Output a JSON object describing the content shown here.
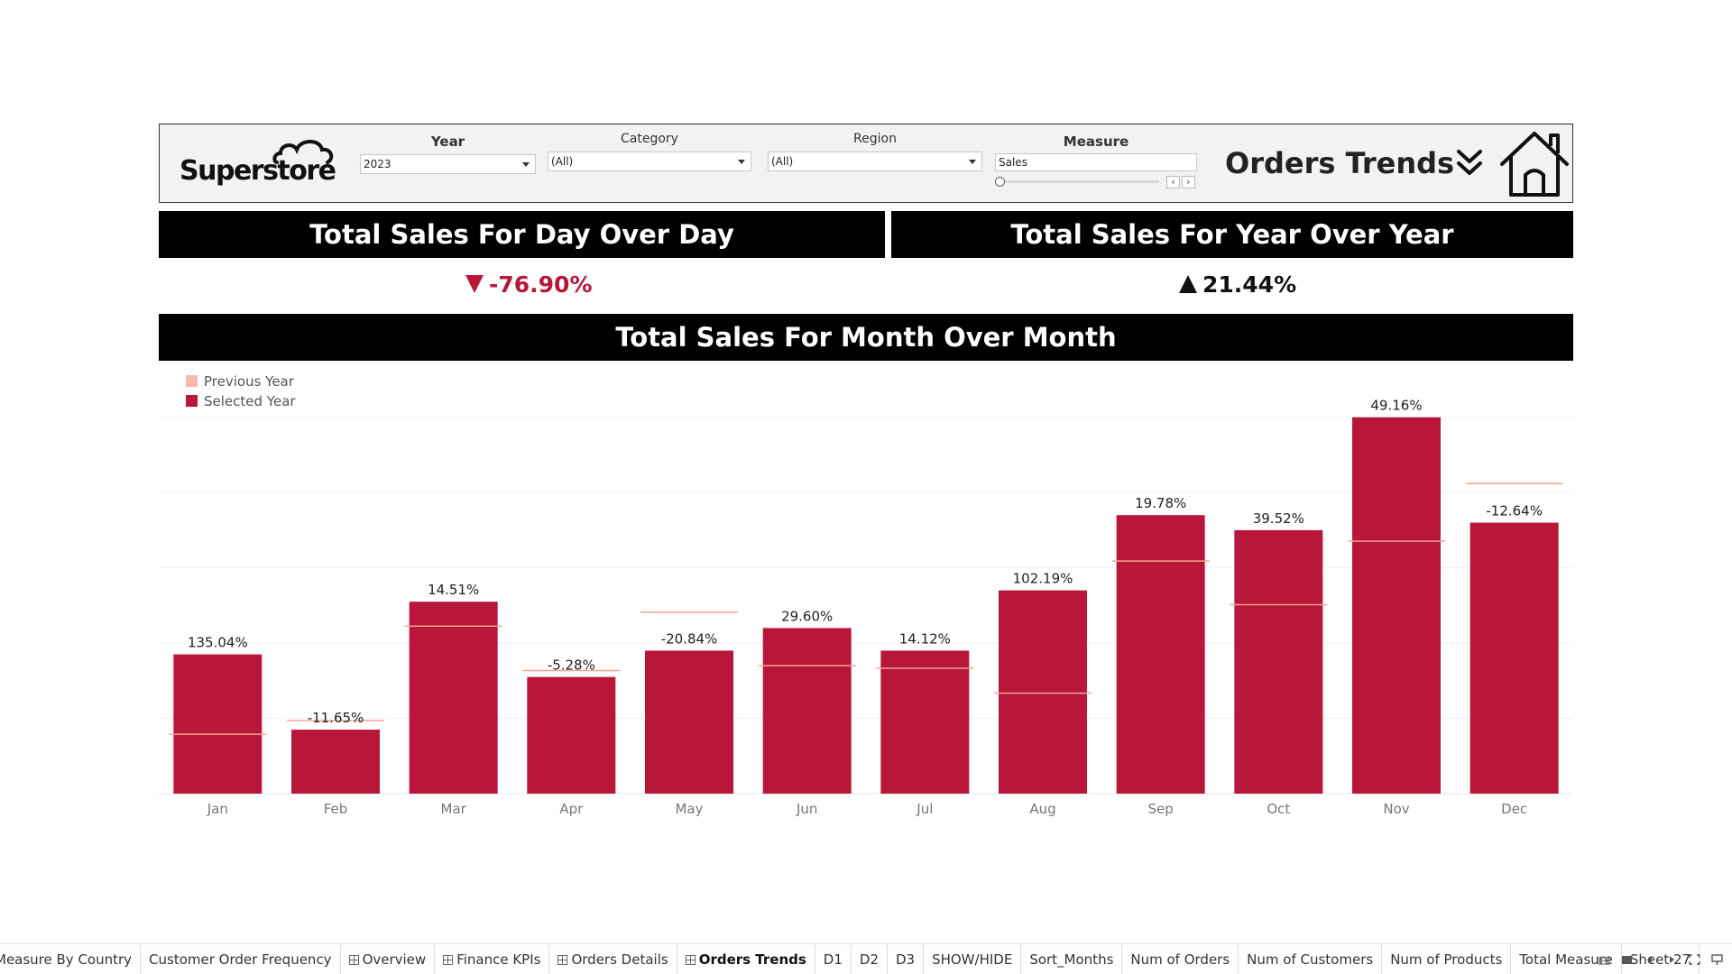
{
  "header": {
    "logo_text": "Superstore",
    "title": "Orders Trends"
  },
  "filters": {
    "year": {
      "label": "Year",
      "value": "2023"
    },
    "category": {
      "label": "Category",
      "value": "(All)"
    },
    "region": {
      "label": "Region",
      "value": "(All)"
    },
    "measure": {
      "label": "Measure",
      "value": "Sales"
    }
  },
  "kpis": {
    "dod": {
      "title": "Total Sales For Day Over Day",
      "value": "-76.90%",
      "direction": "down"
    },
    "yoy": {
      "title": "Total Sales For Year Over Year",
      "value": "21.44%",
      "direction": "up"
    }
  },
  "mom": {
    "title": "Total Sales For Month Over Month"
  },
  "colors": {
    "selected": "#b8173a",
    "previous": "#f8b8ab",
    "previous_line": "#f3a495"
  },
  "chart_data": {
    "type": "bar",
    "categories": [
      "Jan",
      "Feb",
      "Mar",
      "Apr",
      "May",
      "Jun",
      "Jul",
      "Aug",
      "Sep",
      "Oct",
      "Nov",
      "Dec"
    ],
    "series": [
      {
        "name": "Selected Year",
        "values": [
          37,
          17,
          51,
          31,
          38,
          44,
          38,
          54,
          74,
          70,
          100,
          72
        ]
      },
      {
        "name": "Previous Year",
        "values": [
          15.8,
          19.4,
          44.5,
          32.7,
          48.2,
          34,
          33.3,
          26.7,
          61.8,
          50.2,
          67.1,
          82.4
        ]
      }
    ],
    "data_labels": [
      "135.04%",
      "-11.65%",
      "14.51%",
      "-5.28%",
      "-20.84%",
      "29.60%",
      "14.12%",
      "102.19%",
      "19.78%",
      "39.52%",
      "49.16%",
      "-12.64%"
    ],
    "ylim": [
      0,
      104
    ],
    "grid": true,
    "legend": {
      "position": "top-left",
      "entries": [
        "Previous Year",
        "Selected Year"
      ]
    }
  },
  "tabs": [
    {
      "label": "Measure By Country",
      "icon": false,
      "active": false
    },
    {
      "label": "Customer Order Frequency",
      "icon": false,
      "active": false
    },
    {
      "label": "Overview",
      "icon": true,
      "active": false
    },
    {
      "label": "Finance KPIs",
      "icon": true,
      "active": false
    },
    {
      "label": "Orders Details",
      "icon": true,
      "active": false
    },
    {
      "label": "Orders Trends",
      "icon": true,
      "active": true
    },
    {
      "label": "D1",
      "icon": false,
      "active": false
    },
    {
      "label": "D2",
      "icon": false,
      "active": false
    },
    {
      "label": "D3",
      "icon": false,
      "active": false
    },
    {
      "label": "SHOW/HIDE",
      "icon": false,
      "active": false
    },
    {
      "label": "Sort_Months",
      "icon": false,
      "active": false
    },
    {
      "label": "Num of Orders",
      "icon": false,
      "active": false
    },
    {
      "label": "Num of Customers",
      "icon": false,
      "active": false
    },
    {
      "label": "Num of Products",
      "icon": false,
      "active": false
    },
    {
      "label": "Total Measure",
      "icon": false,
      "active": false
    },
    {
      "label": "Sheet 27",
      "icon": false,
      "active": false
    }
  ]
}
